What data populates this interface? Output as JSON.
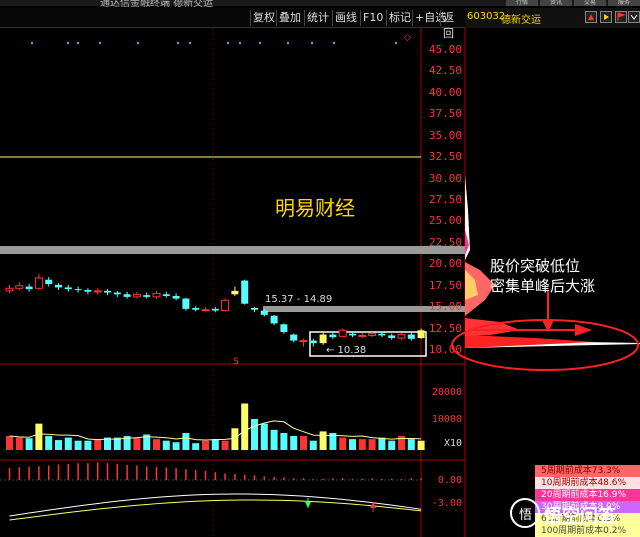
{
  "window": {
    "title": "通达信金融终端 德新交运",
    "top_tabs": [
      "行情",
      "资讯",
      "交易",
      "服务"
    ]
  },
  "toolbar": {
    "buttons": [
      "复权",
      "叠加",
      "统计",
      "画线",
      "F10",
      "标记",
      "+自选",
      "返回"
    ]
  },
  "stock": {
    "code": "603032",
    "name": "德新交运"
  },
  "watermark": "明易财经",
  "annotation": {
    "line1": "股价突破低位",
    "line2": "密集单峰后大涨"
  },
  "price_axis": [
    "45.00",
    "42.50",
    "40.00",
    "37.50",
    "35.00",
    "32.50",
    "30.00",
    "27.50",
    "25.00",
    "22.50",
    "20.00",
    "17.50",
    "15.00",
    "12.50",
    "10.00"
  ],
  "volume_axis": [
    "20000",
    "10000"
  ],
  "volume_unit": "X10",
  "macd_axis": [
    "0.00",
    "-3.00"
  ],
  "labels": {
    "range": "15.37 - 14.89",
    "low_price": "← 10.38"
  },
  "cost_panel": [
    {
      "text": "5周期前成本73.3%",
      "bg": "#ff6666",
      "color": "#7a0000"
    },
    {
      "text": "10周期前成本48.6%",
      "bg": "#ffe0e0",
      "color": "#a00000"
    },
    {
      "text": "20周期前成本16.9%",
      "bg": "#ff3399",
      "color": "#fff"
    },
    {
      "text": "30周期前成本8.0%",
      "bg": "#cc66ff",
      "color": "#fff"
    },
    {
      "text": "60周期前成本0.3%",
      "bg": "#ffff99",
      "color": "#444"
    },
    {
      "text": "100周期前成本0.2%",
      "bg": "#ffff99",
      "color": "#444"
    }
  ],
  "logo": {
    "mark": "悟",
    "text": "悟空问答"
  },
  "colors": {
    "up": "#ff3333",
    "down": "#54ffff",
    "highlight": "#ffff66",
    "ma": "#ffff99"
  },
  "candles": [
    {
      "o": 16.9,
      "c": 17.2,
      "h": 17.6,
      "l": 16.6
    },
    {
      "o": 17.2,
      "c": 17.5,
      "h": 17.9,
      "l": 17.0
    },
    {
      "o": 17.4,
      "c": 17.1,
      "h": 17.7,
      "l": 16.8
    },
    {
      "o": 17.2,
      "c": 18.4,
      "h": 18.9,
      "l": 17.0
    },
    {
      "o": 18.2,
      "c": 17.7,
      "h": 18.5,
      "l": 17.4
    },
    {
      "o": 17.6,
      "c": 17.3,
      "h": 17.8,
      "l": 17.0
    },
    {
      "o": 17.3,
      "c": 17.1,
      "h": 17.6,
      "l": 16.8
    },
    {
      "o": 17.1,
      "c": 17.0,
      "h": 17.4,
      "l": 16.7
    },
    {
      "o": 17.0,
      "c": 16.8,
      "h": 17.2,
      "l": 16.5
    },
    {
      "o": 16.8,
      "c": 16.9,
      "h": 17.2,
      "l": 16.5
    },
    {
      "o": 16.9,
      "c": 16.7,
      "h": 17.1,
      "l": 16.4
    },
    {
      "o": 16.7,
      "c": 16.5,
      "h": 16.9,
      "l": 16.2
    },
    {
      "o": 16.5,
      "c": 16.2,
      "h": 16.8,
      "l": 16.0
    },
    {
      "o": 16.2,
      "c": 16.5,
      "h": 16.8,
      "l": 16.0
    },
    {
      "o": 16.4,
      "c": 16.2,
      "h": 16.7,
      "l": 16.0
    },
    {
      "o": 16.2,
      "c": 16.6,
      "h": 16.9,
      "l": 16.0
    },
    {
      "o": 16.5,
      "c": 16.3,
      "h": 16.8,
      "l": 16.1
    },
    {
      "o": 16.3,
      "c": 16.0,
      "h": 16.6,
      "l": 15.8
    },
    {
      "o": 16.0,
      "c": 14.8,
      "h": 16.1,
      "l": 14.6
    },
    {
      "o": 14.9,
      "c": 14.7,
      "h": 15.1,
      "l": 14.5
    },
    {
      "o": 14.7,
      "c": 14.7,
      "h": 15.0,
      "l": 14.5
    },
    {
      "o": 14.8,
      "c": 14.6,
      "h": 15.0,
      "l": 14.4
    },
    {
      "o": 14.6,
      "c": 15.8,
      "h": 16.0,
      "l": 14.5
    },
    {
      "o": 16.5,
      "c": 16.9,
      "h": 17.4,
      "l": 16.3
    },
    {
      "o": 18.1,
      "c": 15.4,
      "h": 18.2,
      "l": 15.3
    },
    {
      "o": 14.9,
      "c": 14.7,
      "h": 15.0,
      "l": 14.4
    },
    {
      "o": 14.6,
      "c": 14.1,
      "h": 14.8,
      "l": 13.9
    },
    {
      "o": 14.0,
      "c": 13.1,
      "h": 14.1,
      "l": 12.9
    },
    {
      "o": 13.0,
      "c": 12.1,
      "h": 13.1,
      "l": 11.9
    },
    {
      "o": 11.8,
      "c": 11.1,
      "h": 11.9,
      "l": 10.9
    },
    {
      "o": 11.0,
      "c": 11.1,
      "h": 11.3,
      "l": 10.4
    },
    {
      "o": 11.1,
      "c": 10.8,
      "h": 11.3,
      "l": 10.4
    },
    {
      "o": 10.8,
      "c": 11.8,
      "h": 12.0,
      "l": 10.6
    },
    {
      "o": 11.8,
      "c": 11.5,
      "h": 12.1,
      "l": 11.3
    },
    {
      "o": 11.6,
      "c": 12.3,
      "h": 12.5,
      "l": 11.5
    },
    {
      "o": 11.9,
      "c": 11.7,
      "h": 12.1,
      "l": 11.5
    },
    {
      "o": 11.7,
      "c": 11.7,
      "h": 12.0,
      "l": 11.4
    },
    {
      "o": 11.7,
      "c": 11.9,
      "h": 12.1,
      "l": 11.5
    },
    {
      "o": 11.9,
      "c": 11.7,
      "h": 12.1,
      "l": 11.5
    },
    {
      "o": 11.7,
      "c": 11.4,
      "h": 11.9,
      "l": 11.2
    },
    {
      "o": 11.4,
      "c": 11.8,
      "h": 12.0,
      "l": 11.2
    },
    {
      "o": 11.8,
      "c": 11.3,
      "h": 12.0,
      "l": 11.1
    },
    {
      "o": 11.4,
      "c": 12.3,
      "h": 12.5,
      "l": 11.3
    }
  ],
  "volumes": [
    4500,
    4000,
    3800,
    8500,
    4500,
    3200,
    4000,
    3000,
    3000,
    3500,
    4000,
    4000,
    4500,
    3800,
    5000,
    3500,
    3000,
    2500,
    5500,
    2200,
    3000,
    3500,
    3000,
    7000,
    15000,
    10000,
    8500,
    6500,
    5500,
    4500,
    4500,
    3000,
    6000,
    5500,
    4000,
    3500,
    3500,
    3500,
    4000,
    3000,
    4500,
    3500,
    3000
  ],
  "macd_bars": [
    2.0,
    2.1,
    2.2,
    2.3,
    2.4,
    2.6,
    2.7,
    2.8,
    2.8,
    2.9,
    2.8,
    2.7,
    2.5,
    2.4,
    2.3,
    2.2,
    2.1,
    2.0,
    1.8,
    1.7,
    1.5,
    1.3,
    1.1,
    1.0,
    0.9,
    0.8,
    0.6,
    0.5,
    0.4,
    0.3,
    0.3,
    0.2,
    0.2,
    0.3,
    0.3,
    0.2,
    0.2,
    0.3,
    0.2,
    0.2,
    0.2,
    0.3,
    0.3
  ]
}
